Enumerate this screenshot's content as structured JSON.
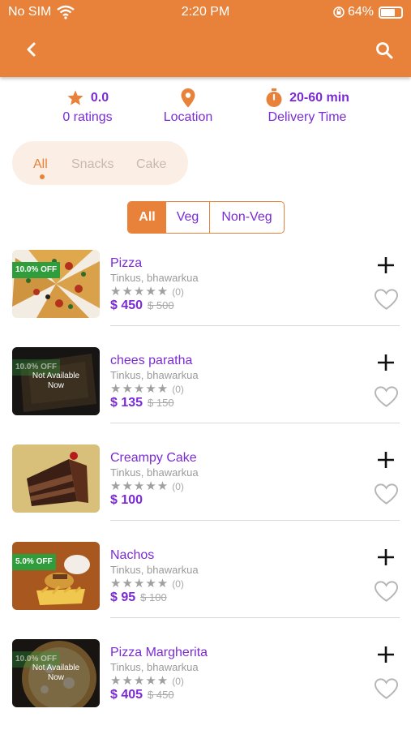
{
  "status_bar": {
    "carrier": "No SIM",
    "time": "2:20 PM",
    "battery": "64%"
  },
  "header": {
    "back_icon": "chevron-left-icon",
    "search_icon": "search-icon"
  },
  "info": {
    "rating_value": "0.0",
    "rating_label": "0 ratings",
    "location_label": "Location",
    "delivery_value": "20-60 min",
    "delivery_label": "Delivery Time"
  },
  "categories": [
    "All",
    "Snacks",
    "Cake"
  ],
  "filter": [
    "All",
    "Veg",
    "Non-Veg"
  ],
  "items": [
    {
      "name": "Pizza",
      "location": "Tinkus, bhawarkua",
      "stars": "★★★★★",
      "rating_count": "(0)",
      "price": "$ 450",
      "old_price": "$ 500",
      "discount": "10.0% OFF",
      "availability": ""
    },
    {
      "name": "chees paratha",
      "location": "Tinkus, bhawarkua",
      "stars": "★★★★★",
      "rating_count": "(0)",
      "price": "$ 135",
      "old_price": "$ 150",
      "discount": "10.0% OFF",
      "availability": "Not Available Now"
    },
    {
      "name": "Creampy Cake",
      "location": "Tinkus, bhawarkua",
      "stars": "★★★★★",
      "rating_count": "(0)",
      "price": "$ 100",
      "old_price": "",
      "discount": "",
      "availability": ""
    },
    {
      "name": "Nachos",
      "location": "Tinkus, bhawarkua",
      "stars": "★★★★★",
      "rating_count": "(0)",
      "price": "$ 95",
      "old_price": "$ 100",
      "discount": "5.0% OFF",
      "availability": ""
    },
    {
      "name": "Pizza Margherita",
      "location": "Tinkus, bhawarkua",
      "stars": "★★★★★",
      "rating_count": "(0)",
      "price": "$ 405",
      "old_price": "$ 450",
      "discount": "10.0% OFF",
      "availability": "Not Available Now"
    }
  ],
  "colors": {
    "accent": "#e8823a",
    "purple": "#7b2bd6",
    "discount": "#2f9d3c"
  }
}
